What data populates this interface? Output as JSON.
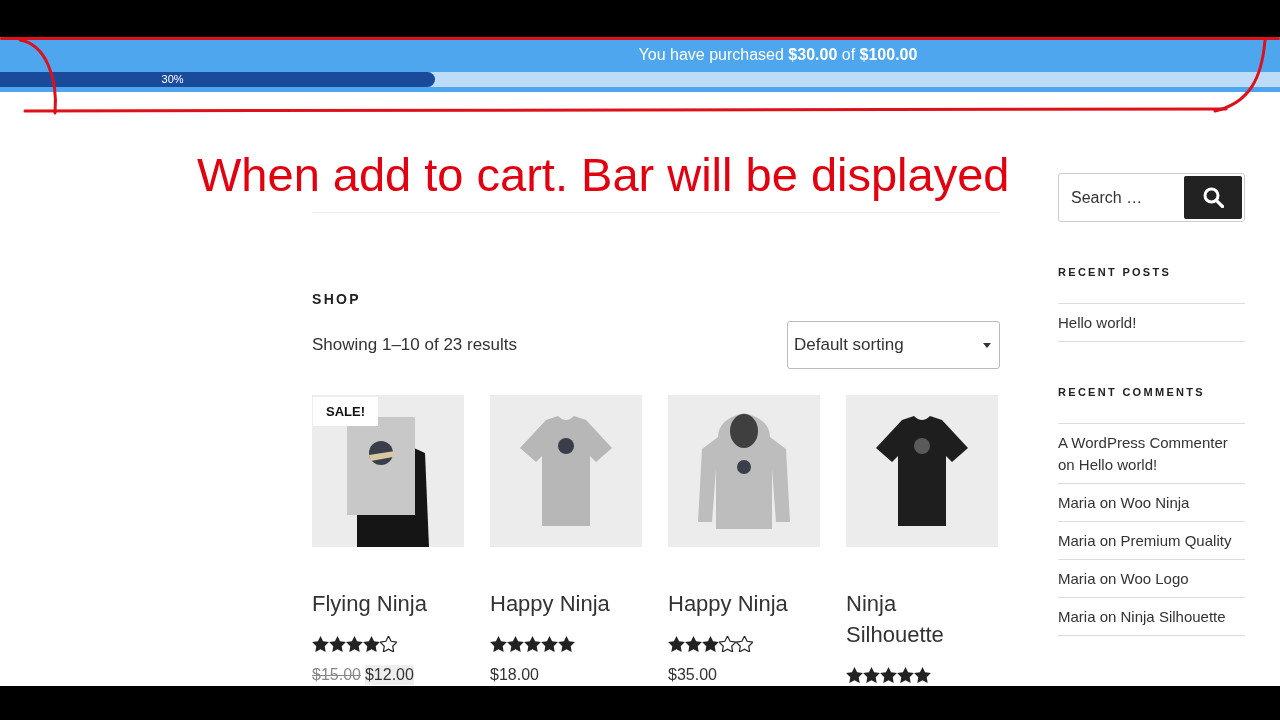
{
  "purchase_bar": {
    "message": "You have purchased **$30.00** of **$100.00**",
    "progress": {
      "label": "30%",
      "level": 0.34
    }
  },
  "annotation": {
    "text": "When add to cart. Bar will be displayed"
  },
  "shop": {
    "title": "SHOP",
    "result_count": "Showing 1–10 of 23 results",
    "sorting": {
      "value": "Default sorting"
    }
  },
  "products": [
    {
      "name": "Flying Ninja",
      "photo": {
        "kind": "poster"
      },
      "badge": "SALE!",
      "stars": 4,
      "old_price": "$15.00",
      "price": "$12.00"
    },
    {
      "name": "Happy Ninja",
      "photo": {
        "kind": "tshirt"
      },
      "stars": 5,
      "price": "$18.00"
    },
    {
      "name": "Happy Ninja",
      "photo": {
        "kind": "hoodie"
      },
      "stars": 3,
      "price": "$35.00"
    },
    {
      "name": "Ninja Silhouette",
      "photo": {
        "kind": "darkshirt"
      },
      "stars": 5
    }
  ],
  "sidebar": {
    "search": {
      "placeholder": "Search …"
    },
    "recent_posts": {
      "title": "RECENT POSTS",
      "items": [
        "Hello world!"
      ]
    },
    "recent_comments": {
      "title": "RECENT COMMENTS",
      "items": [
        "A WordPress Commenter on Hello world!",
        "Maria on Woo Ninja",
        "Maria on Premium Quality",
        "Maria on Woo Logo",
        "Maria on Ninja Silhouette"
      ]
    }
  }
}
